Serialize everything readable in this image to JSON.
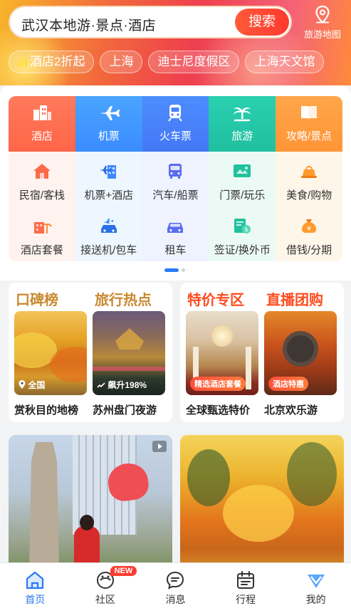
{
  "search": {
    "placeholder": "武汉本地游·景点·酒店",
    "button": "搜索"
  },
  "map_button": {
    "label": "旅游地图",
    "icon": "map-pin-icon"
  },
  "chips": [
    {
      "label": "酒店2折起",
      "icon": "bar-chart-icon"
    },
    {
      "label": "上海"
    },
    {
      "label": "迪士尼度假区"
    },
    {
      "label": "上海天文馆"
    }
  ],
  "main_categories": [
    {
      "label": "酒店",
      "icon": "hotel-icon"
    },
    {
      "label": "机票",
      "icon": "plane-icon"
    },
    {
      "label": "火车票",
      "icon": "train-icon"
    },
    {
      "label": "旅游",
      "icon": "palm-tree-icon"
    },
    {
      "label": "攻略/景点",
      "icon": "book-icon"
    }
  ],
  "sub_categories": [
    {
      "label": "民宿/客栈",
      "icon": "house-icon"
    },
    {
      "label": "机票+酒店",
      "icon": "plane-hotel-icon"
    },
    {
      "label": "汽车/船票",
      "icon": "bus-icon"
    },
    {
      "label": "门票/玩乐",
      "icon": "ticket-icon"
    },
    {
      "label": "美食/购物",
      "icon": "food-icon"
    },
    {
      "label": "酒店套餐",
      "icon": "hotel-package-icon"
    },
    {
      "label": "接送机/包车",
      "icon": "airport-car-icon"
    },
    {
      "label": "租车",
      "icon": "car-icon"
    },
    {
      "label": "签证/换外币",
      "icon": "visa-icon"
    },
    {
      "label": "借钱/分期",
      "icon": "money-bag-icon"
    }
  ],
  "features": {
    "left": {
      "titles": [
        "口碑榜",
        "旅行热点"
      ],
      "items": [
        {
          "tag": "全国",
          "caption": "赏秋目的地榜"
        },
        {
          "tag": "飙升198%",
          "caption": "苏州盘门夜游"
        }
      ]
    },
    "right": {
      "titles": [
        "特价专区",
        "直播团购"
      ],
      "items": [
        {
          "tag": "精选酒店套餐",
          "caption": "全球甄选特价"
        },
        {
          "tag": "酒店特惠",
          "caption": "北京欢乐游"
        }
      ]
    }
  },
  "tabs": [
    {
      "label": "首页",
      "icon": "home-icon",
      "active": true
    },
    {
      "label": "社区",
      "icon": "community-icon",
      "badge": "NEW"
    },
    {
      "label": "消息",
      "icon": "message-icon"
    },
    {
      "label": "行程",
      "icon": "calendar-icon"
    },
    {
      "label": "我的",
      "icon": "profile-icon"
    }
  ],
  "colors": {
    "accent": "#2a78f5",
    "search_button": "#ff3a2e",
    "feature_title": "#c9892e",
    "feature_title_red": "#ff4b1f"
  }
}
